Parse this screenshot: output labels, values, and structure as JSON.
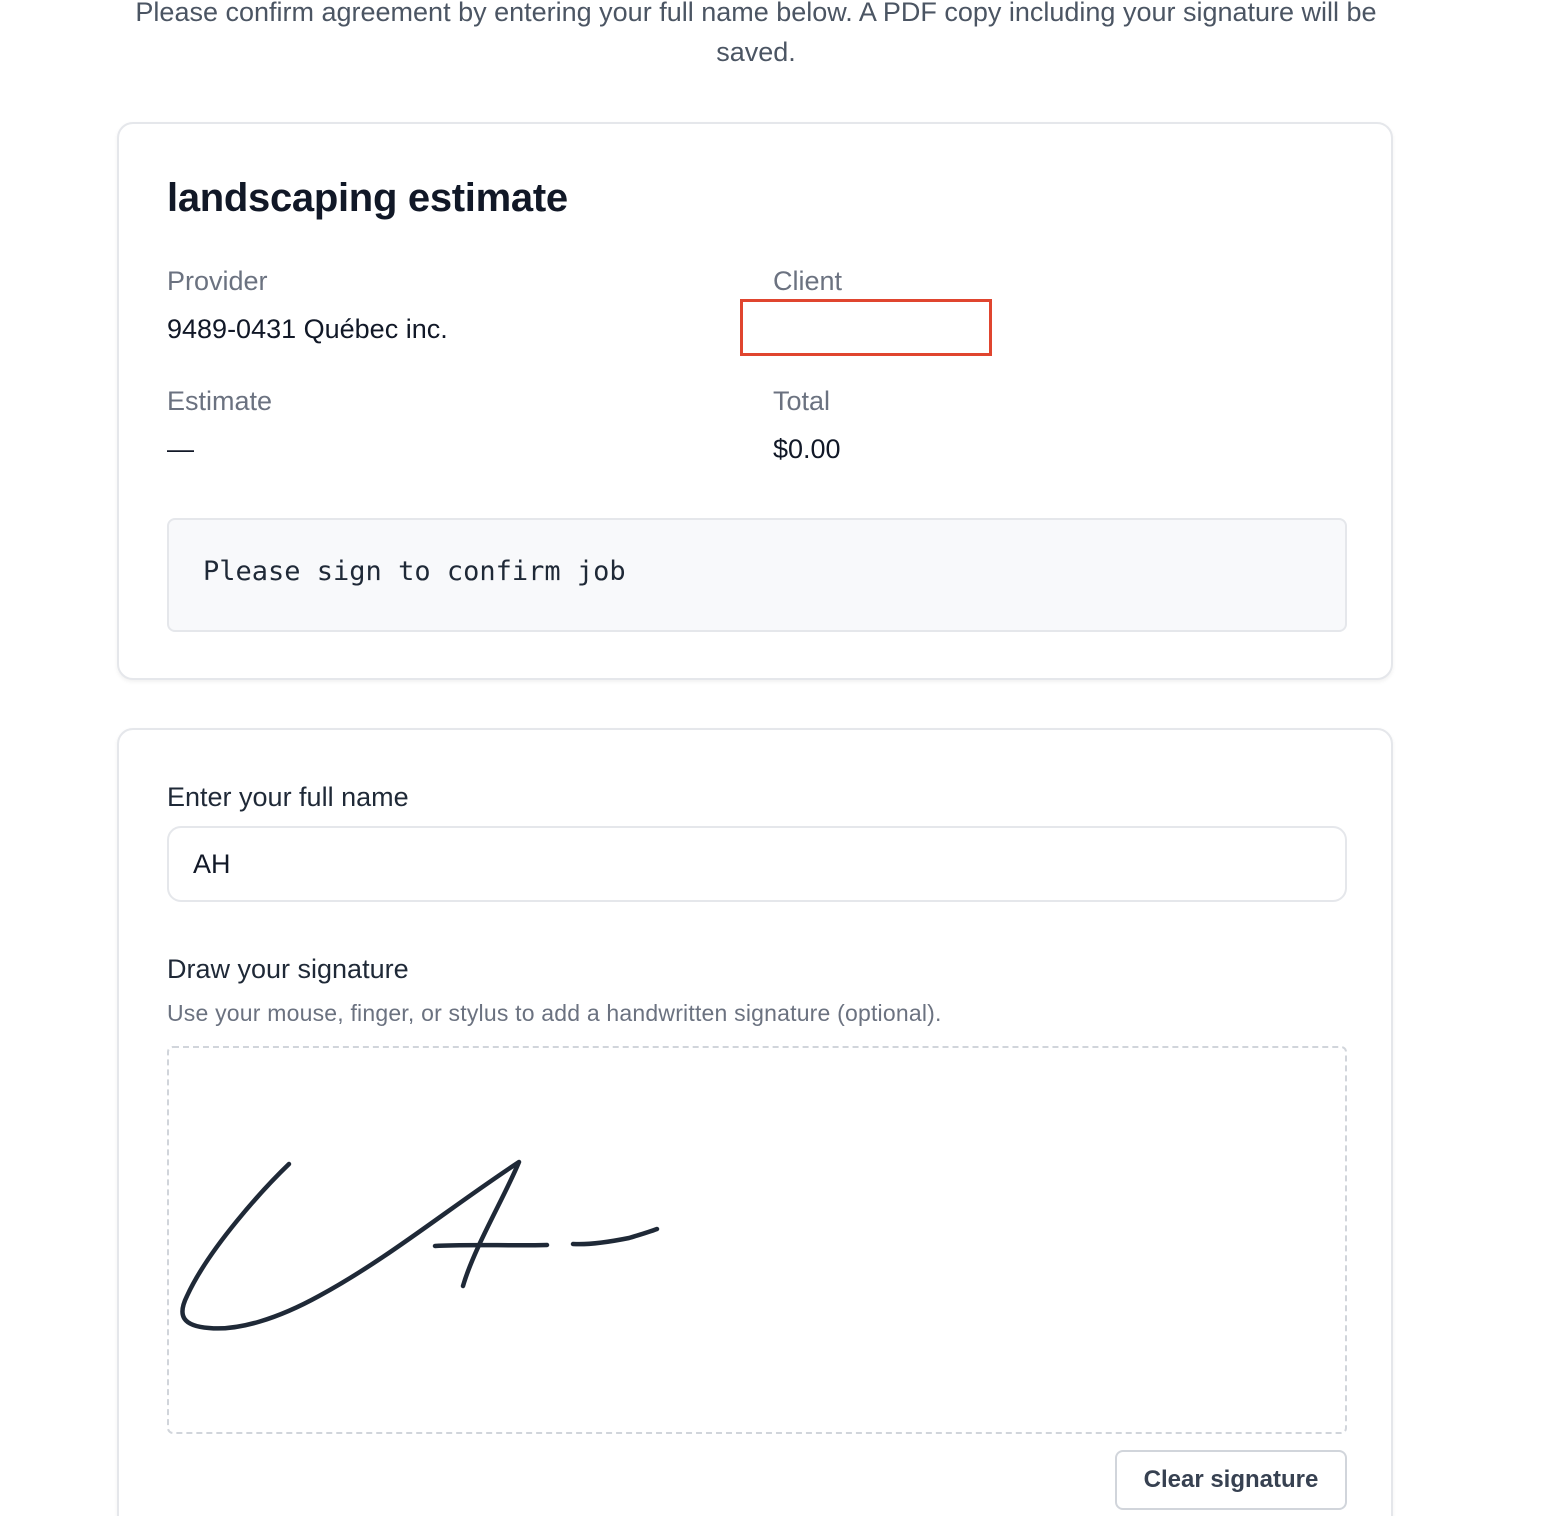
{
  "intro": {
    "text": "Please confirm agreement by entering your full name below. A PDF copy including your signature will be saved."
  },
  "estimate": {
    "title": "landscaping estimate",
    "provider_label": "Provider",
    "provider_value": "9489-0431 Québec inc.",
    "client_label": "Client",
    "client_value": "",
    "estimate_label": "Estimate",
    "estimate_value": "—",
    "total_label": "Total",
    "total_value": "$0.00",
    "message": "Please sign to confirm job"
  },
  "signing": {
    "name_label": "Enter your full name",
    "name_value": "AH",
    "signature_label": "Draw your signature",
    "signature_help": "Use your mouse, finger, or stylus to add a handwritten signature (optional).",
    "clear_button_label": "Clear signature"
  },
  "colors": {
    "highlight": "#e0452f",
    "signature_ink": "#1f2937"
  }
}
